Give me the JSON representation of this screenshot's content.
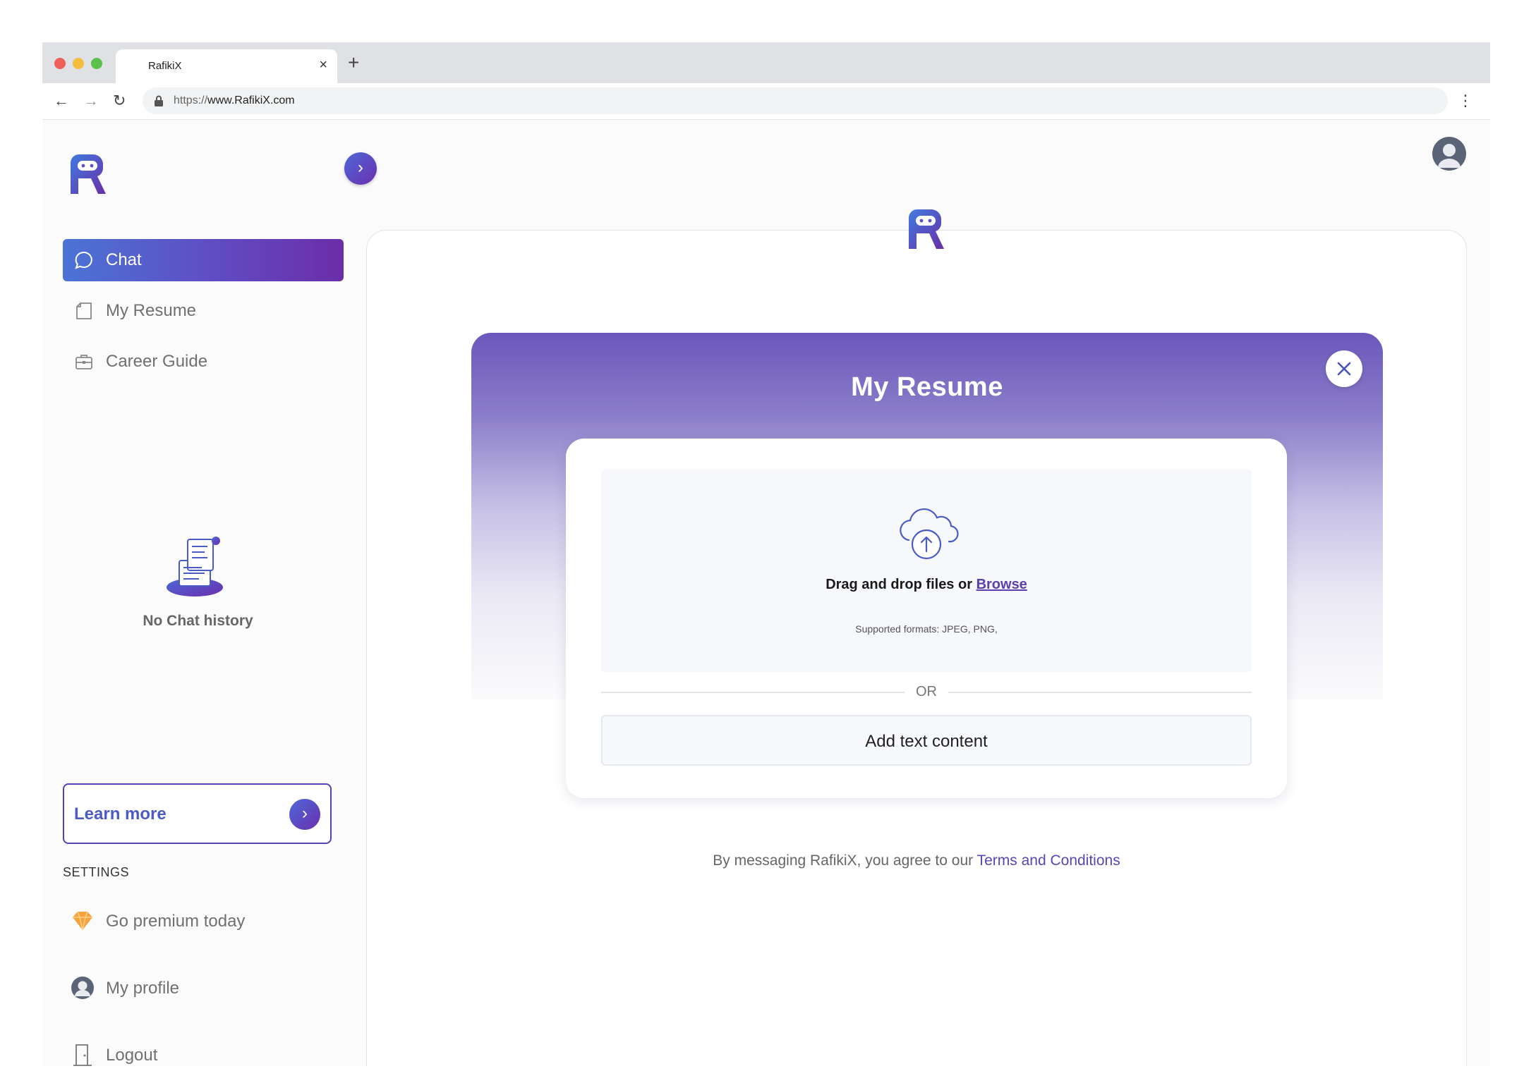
{
  "browser": {
    "tab_title": "RafikiX",
    "tab_close": "×",
    "new_tab": "+",
    "url_prefix": "https://",
    "url_host": "www.RafikiX.com"
  },
  "sidebar": {
    "items": [
      {
        "label": "Chat",
        "icon": "chat-bubble-icon",
        "active": true
      },
      {
        "label": "My Resume",
        "icon": "document-icon",
        "active": false
      },
      {
        "label": "Career Guide",
        "icon": "briefcase-icon",
        "active": false
      }
    ],
    "empty_state": "No Chat history",
    "learn_more": "Learn more",
    "settings_heading": "SETTINGS",
    "settings_items": [
      {
        "label": "Go premium today",
        "icon": "diamond-icon"
      },
      {
        "label": "My profile",
        "icon": "profile-icon"
      },
      {
        "label": "Logout",
        "icon": "door-icon"
      }
    ]
  },
  "modal": {
    "title": "My Resume",
    "drop_text": "Drag and drop files or",
    "browse_label": "Browse",
    "formats": "Supported formats: JPEG, PNG,",
    "or_label": "OR",
    "add_text_label": "Add text content"
  },
  "footer": {
    "terms_prefix": "By messaging RafikiX, you agree to our",
    "terms_link": "Terms and Conditions"
  },
  "colors": {
    "accent_blue": "#4a74d6",
    "accent_purple": "#6a2ea8",
    "link": "#5a45b6"
  }
}
